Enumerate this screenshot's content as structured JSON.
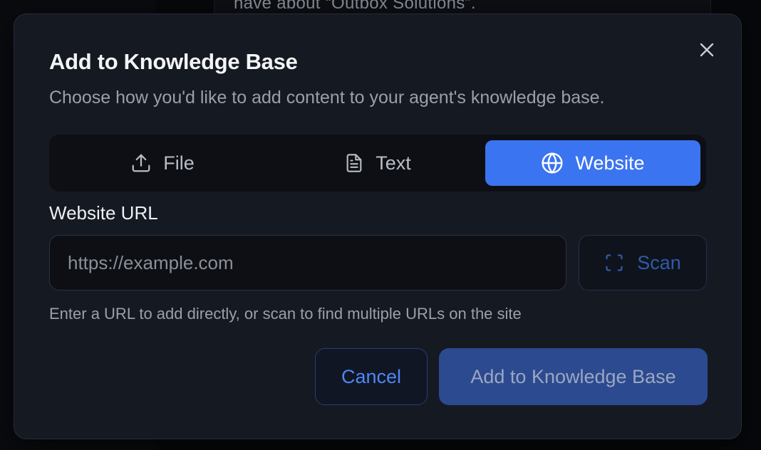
{
  "background": {
    "text": "have about “Outbox Solutions”."
  },
  "dialog": {
    "title": "Add to Knowledge Base",
    "subtitle": "Choose how you'd like to add content to your agent's knowledge base.",
    "close_icon": "close-icon",
    "tabs": [
      {
        "label": "File",
        "icon": "upload-icon",
        "active": false
      },
      {
        "label": "Text",
        "icon": "document-icon",
        "active": false
      },
      {
        "label": "Website",
        "icon": "globe-icon",
        "active": true
      }
    ],
    "url_field": {
      "label": "Website URL",
      "placeholder": "https://example.com",
      "value": ""
    },
    "scan_button": {
      "label": "Scan",
      "icon": "scan-icon"
    },
    "helper_text": "Enter a URL to add directly, or scan to find multiple URLs on the site",
    "cancel_button": {
      "label": "Cancel"
    },
    "submit_button": {
      "label": "Add to Knowledge Base",
      "disabled": true
    }
  },
  "colors": {
    "accent": "#3b74f0",
    "dialog_bg": "#151922",
    "disabled_button": "#2c4a8f"
  }
}
